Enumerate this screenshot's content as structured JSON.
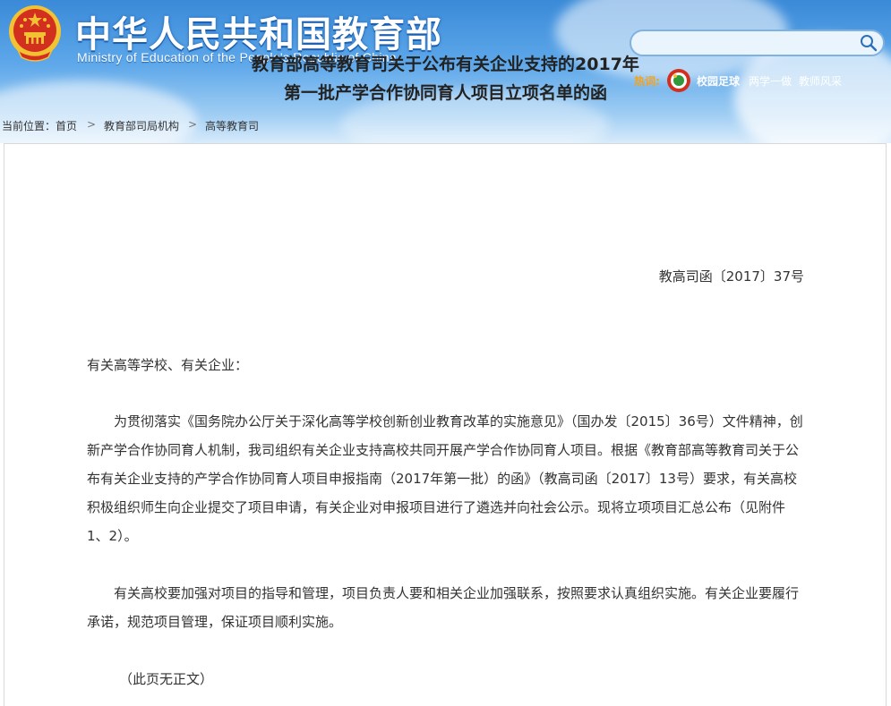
{
  "header": {
    "title_cn": "中华人民共和国教育部",
    "title_en": "Ministry of Education of the People's Republic of China",
    "search_placeholder": "",
    "hot_label": "热词:",
    "hot_items": [
      "校园足球",
      "两学一做",
      "教师风采"
    ]
  },
  "breadcrumb": {
    "label": "当前位置：",
    "items": [
      "首页",
      "教育部司局机构",
      "高等教育司"
    ],
    "separator": ">"
  },
  "document": {
    "title_line1": "教育部高等教育司关于公布有关企业支持的2017年",
    "title_line2": "第一批产学合作协同育人项目立项名单的函",
    "number": "教高司函〔2017〕37号",
    "addressee": "有关高等学校、有关企业：",
    "para1": "为贯彻落实《国务院办公厅关于深化高等学校创新创业教育改革的实施意见》（国办发〔2015〕36号）文件精神，创新产学合作协同育人机制，我司组织有关企业支持高校共同开展产学合作协同育人项目。根据《教育部高等教育司关于公布有关企业支持的产学合作协同育人项目申报指南（2017年第一批）的函》（教高司函〔2017〕13号）要求，有关高校积极组织师生向企业提交了项目申请，有关企业对申报项目进行了遴选并向社会公示。现将立项项目汇总公布（见附件1、2）。",
    "para2": "有关高校要加强对项目的指导和管理，项目负责人要和相关企业加强联系，按照要求认真组织实施。有关企业要履行承诺，规范项目管理，保证项目顺利实施。",
    "note": "（此页无正文）"
  },
  "colors": {
    "header_blue": "#3a8ad8",
    "hot_label": "#f3a21e",
    "emblem_red": "#d32f1f",
    "emblem_gold": "#f2c232"
  },
  "icons": [
    "national-emblem-icon",
    "search-icon",
    "campus-football-logo-icon"
  ]
}
